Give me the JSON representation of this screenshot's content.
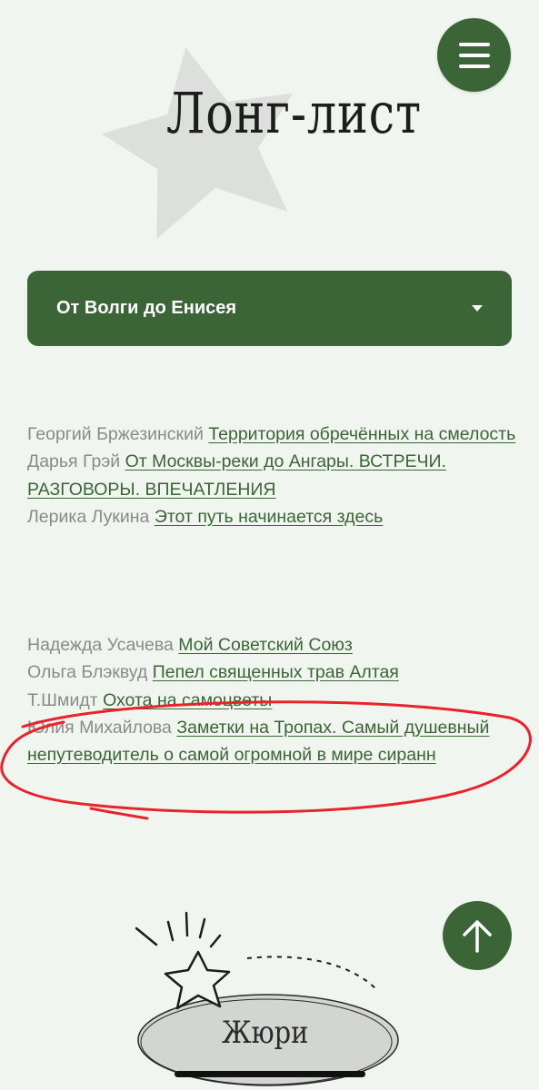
{
  "header": {
    "menu_icon": "hamburger-icon"
  },
  "hero": {
    "title": "Лонг-лист",
    "decoration": "star-icon"
  },
  "selector": {
    "selected": "От Волги до Енисея",
    "icon": "caret-down-icon"
  },
  "entries_group_1": [
    {
      "author": "Георгий Бржезинский",
      "title": "Территория обречённых на смелость"
    },
    {
      "author": "Дарья Грэй",
      "title": "От Москвы-реки до Ангары. ВСТРЕЧИ. РАЗГОВОРЫ. ВПЕЧАТЛЕНИЯ"
    },
    {
      "author": "Лерика Лукина",
      "title": "Этот путь начинается здесь"
    }
  ],
  "entries_group_2": [
    {
      "author": "Надежда Усачева",
      "title": "Мой Советский Союз"
    },
    {
      "author": "Ольга Блэквуд",
      "title": "Пепел священных трав Алтая"
    },
    {
      "author": "Т.Шмидт",
      "title": "Охота на самоцветы"
    },
    {
      "author": "Юлия Михайлова",
      "title": "Заметки на Тропах. Самый душевный непутеводитель о самой огромной в мире сиранн"
    }
  ],
  "jury": {
    "label": "Жюри",
    "icon": "star-icon"
  },
  "scroll_top": {
    "icon": "arrow-up-icon"
  },
  "colors": {
    "accent": "#3b6537",
    "background": "#f1f5ef",
    "annotation": "#e8232b"
  }
}
